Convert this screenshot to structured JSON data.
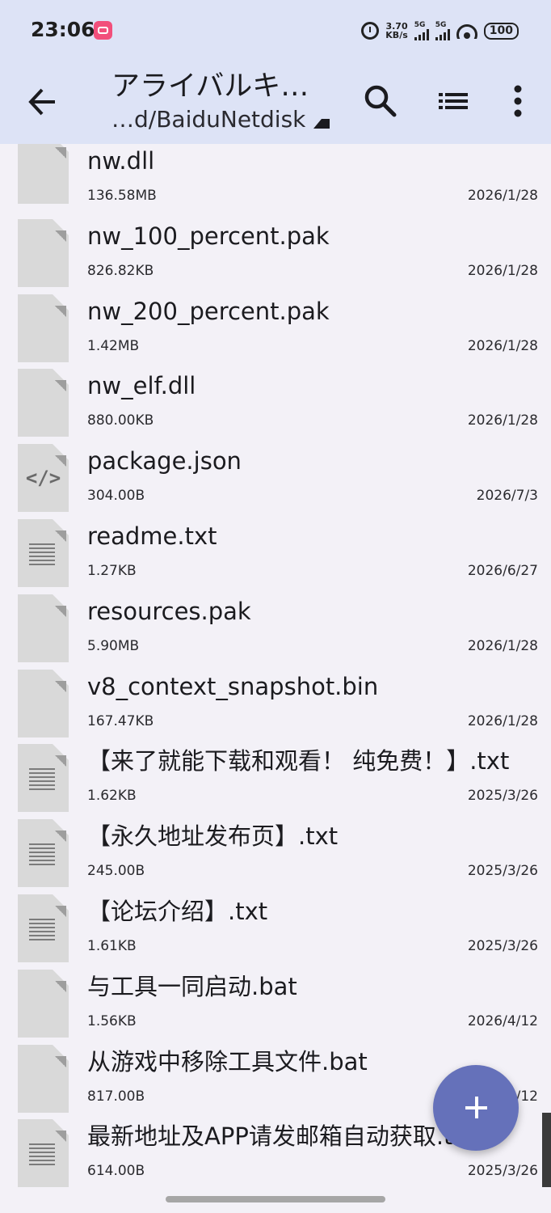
{
  "status_bar": {
    "time": "23:06",
    "net_speed_value": "3.70",
    "net_speed_unit": "KB/s",
    "sim1": "5G",
    "sim2": "5G",
    "battery": "100"
  },
  "app_bar": {
    "title": "アライバルキ…",
    "path": "…d/BaiduNetdisk"
  },
  "files": [
    {
      "name": "nw.dll",
      "size": "136.58MB",
      "date": "2026/1/28",
      "icon": "generic-file-icon"
    },
    {
      "name": "nw_100_percent.pak",
      "size": "826.82KB",
      "date": "2026/1/28",
      "icon": "generic-file-icon"
    },
    {
      "name": "nw_200_percent.pak",
      "size": "1.42MB",
      "date": "2026/1/28",
      "icon": "generic-file-icon"
    },
    {
      "name": "nw_elf.dll",
      "size": "880.00KB",
      "date": "2026/1/28",
      "icon": "generic-file-icon"
    },
    {
      "name": "package.json",
      "size": "304.00B",
      "date": "2026/7/3",
      "icon": "code-file-icon"
    },
    {
      "name": "readme.txt",
      "size": "1.27KB",
      "date": "2026/6/27",
      "icon": "text-file-icon"
    },
    {
      "name": "resources.pak",
      "size": "5.90MB",
      "date": "2026/1/28",
      "icon": "generic-file-icon"
    },
    {
      "name": "v8_context_snapshot.bin",
      "size": "167.47KB",
      "date": "2026/1/28",
      "icon": "generic-file-icon"
    },
    {
      "name": "【来了就能下载和观看！ 纯免费！】.txt",
      "size": "1.62KB",
      "date": "2025/3/26",
      "icon": "text-file-icon"
    },
    {
      "name": "【永久地址发布页】.txt",
      "size": "245.00B",
      "date": "2025/3/26",
      "icon": "text-file-icon"
    },
    {
      "name": "【论坛介绍】.txt",
      "size": "1.61KB",
      "date": "2025/3/26",
      "icon": "text-file-icon"
    },
    {
      "name": "与工具一同启动.bat",
      "size": "1.56KB",
      "date": "2026/4/12",
      "icon": "generic-file-icon"
    },
    {
      "name": "从游戏中移除工具文件.bat",
      "size": "817.00B",
      "date": "2026/4/12",
      "icon": "generic-file-icon"
    },
    {
      "name": "最新地址及APP请发邮箱自动获取.txt",
      "size": "614.00B",
      "date": "2025/3/26",
      "icon": "text-file-icon"
    }
  ],
  "colors": {
    "app_bar_bg": "#dde3f6",
    "list_bg": "#f3f1f7",
    "fab": "#6571ba"
  }
}
